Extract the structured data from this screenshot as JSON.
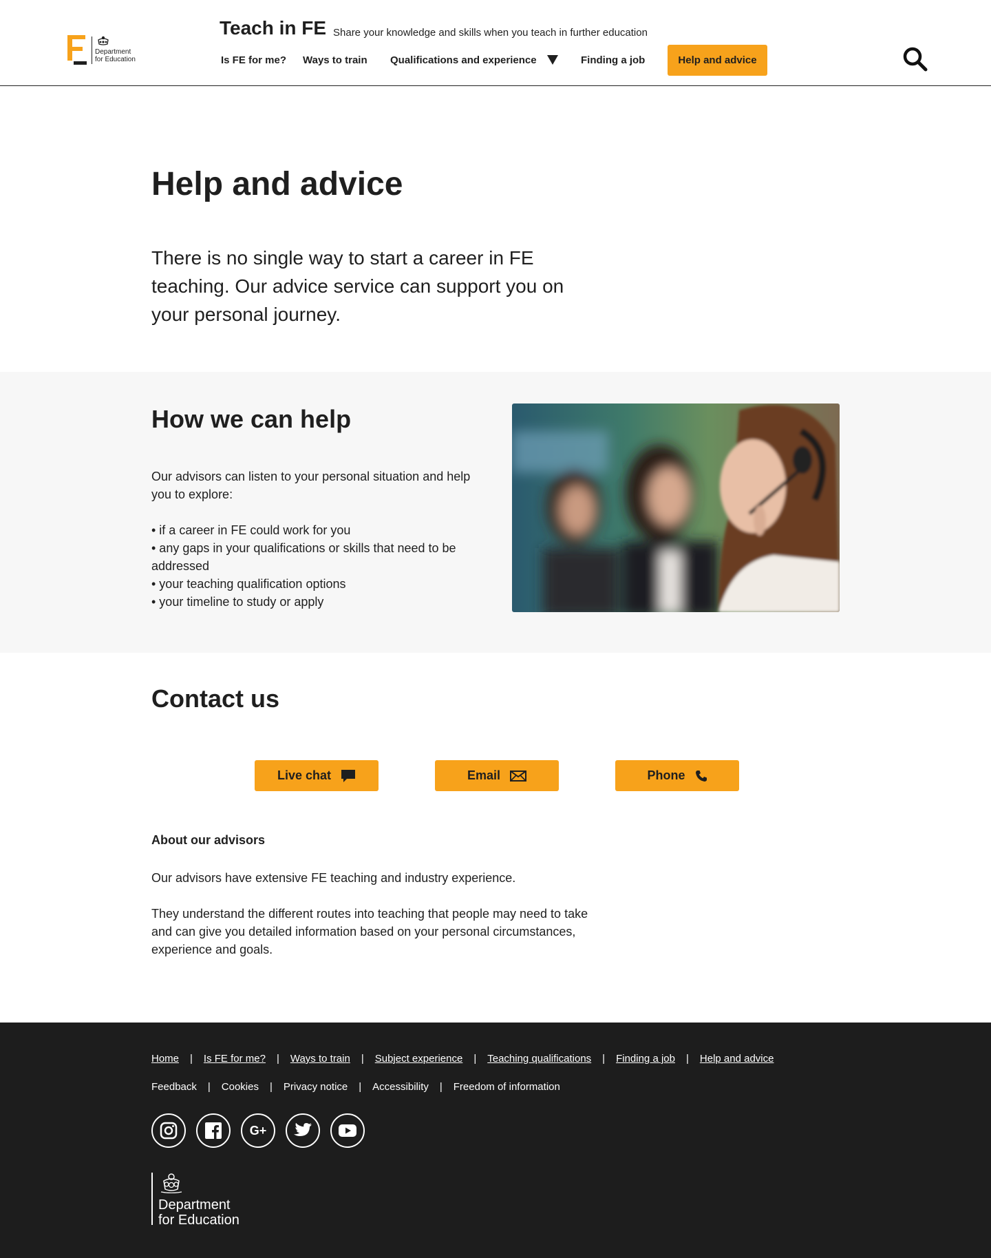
{
  "header": {
    "logo_text_line1": "Department",
    "logo_text_line2": "for Education",
    "site_title": "Teach in FE",
    "tagline": "Share your knowledge and skills when you teach in further education",
    "nav": {
      "is_fe_for_me": "Is FE for me?",
      "ways_to_train": "Ways to train",
      "qualifications": "Qualifications and experience",
      "finding_a_job": "Finding a job",
      "help_and_advice": "Help and advice"
    },
    "search_icon": "search-icon",
    "caret_icon": "triangle-down-icon"
  },
  "hero": {
    "title": "Help and advice",
    "lead": "There is no single way to start a career in FE teaching. Our advice service can support you on your personal journey."
  },
  "help": {
    "title": "How we can help",
    "intro": "Our advisors can listen to your personal situation and help you to explore:",
    "items": [
      "• if a career in FE could work for you",
      "• any gaps in your qualifications or skills that need to be addressed",
      "• your teaching qualification options",
      "• your timeline to study or apply"
    ]
  },
  "contact": {
    "title": "Contact us",
    "buttons": {
      "live_chat": "Live chat",
      "email": "Email",
      "phone": "Phone"
    },
    "icons": [
      "chat-bubble-icon",
      "envelope-icon",
      "phone-icon"
    ]
  },
  "about": {
    "heading": "About our advisors",
    "p1": "Our advisors have extensive FE teaching and industry experience.",
    "p2": "They understand the different routes into teaching that people may need to take and can give you detailed information based on your personal circumstances, experience and goals."
  },
  "footer": {
    "links_primary": [
      "Home",
      "Is FE for me?",
      "Ways to train",
      "Subject experience",
      "Teaching qualifications",
      "Finding a job",
      "Help and advice"
    ],
    "links_secondary": [
      "Feedback",
      "Cookies",
      "Privacy notice",
      "Accessibility",
      "Freedom of information"
    ],
    "separator": "|",
    "socials": [
      "instagram-icon",
      "facebook-icon",
      "google-plus-icon",
      "twitter-icon",
      "youtube-icon"
    ],
    "google_plus_glyph": "G+",
    "logo_line1": "Department",
    "logo_line2": "for Education"
  },
  "colors": {
    "accent": "#f7a21b",
    "text": "#1f1f1f",
    "section_bg": "#f7f7f7",
    "footer_bg": "#1d1d1d"
  }
}
